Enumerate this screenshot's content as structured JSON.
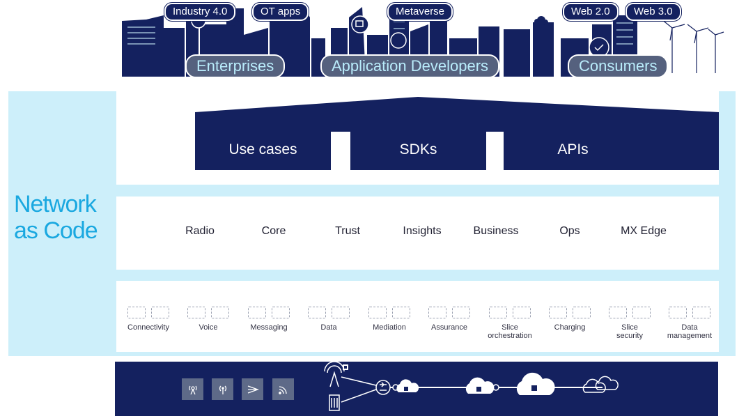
{
  "top": {
    "tags": [
      "Industry 4.0",
      "OT apps",
      "Metaverse",
      "Web 2.0",
      "Web 3.0"
    ],
    "audiences": [
      "Enterprises",
      "Application Developers",
      "Consumers"
    ]
  },
  "network_as_code": {
    "title_line1": "Network",
    "title_line2": "as Code"
  },
  "layers": {
    "top_blocks": [
      "Use cases",
      "SDKs",
      "APIs"
    ],
    "domains": [
      "Radio",
      "Core",
      "Trust",
      "Insights",
      "Business",
      "Ops",
      "MX Edge"
    ],
    "capabilities": [
      {
        "l1": "Connectivity",
        "l2": ""
      },
      {
        "l1": "Voice",
        "l2": ""
      },
      {
        "l1": "Messaging",
        "l2": ""
      },
      {
        "l1": "Data",
        "l2": ""
      },
      {
        "l1": "Mediation",
        "l2": ""
      },
      {
        "l1": "Assurance",
        "l2": ""
      },
      {
        "l1": "Slice",
        "l2": "orchestration"
      },
      {
        "l1": "Charging",
        "l2": ""
      },
      {
        "l1": "Slice",
        "l2": "security"
      },
      {
        "l1": "Data",
        "l2": "management"
      }
    ]
  },
  "infrastructure": {
    "icons": [
      "antenna-icon",
      "signal-icon",
      "send-icon",
      "wifi-icon",
      "tower-icon",
      "server-icon",
      "router-icon",
      "cloud-icon"
    ]
  },
  "colors": {
    "navy": "#14215f",
    "light_blue": "#cdeffa",
    "brand_blue": "#1aa8e0",
    "gray_pill": "#55617e"
  }
}
